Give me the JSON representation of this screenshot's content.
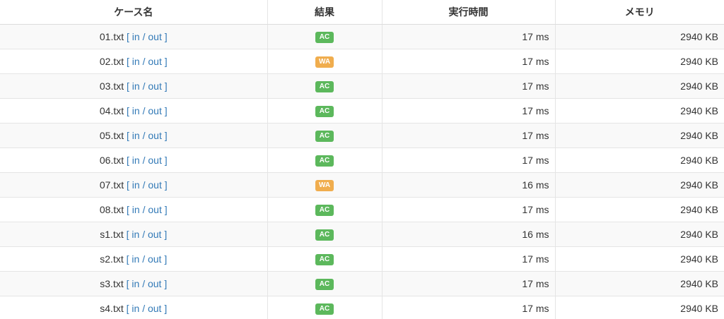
{
  "headers": {
    "case": "ケース名",
    "status": "結果",
    "time": "実行時間",
    "memory": "メモリ"
  },
  "link_labels": {
    "in": "in",
    "out": "out"
  },
  "status_colors": {
    "AC": "#5cb85c",
    "WA": "#f0ad4e"
  },
  "rows": [
    {
      "case": "01.txt",
      "status": "AC",
      "time": "17 ms",
      "memory": "2940 KB"
    },
    {
      "case": "02.txt",
      "status": "WA",
      "time": "17 ms",
      "memory": "2940 KB"
    },
    {
      "case": "03.txt",
      "status": "AC",
      "time": "17 ms",
      "memory": "2940 KB"
    },
    {
      "case": "04.txt",
      "status": "AC",
      "time": "17 ms",
      "memory": "2940 KB"
    },
    {
      "case": "05.txt",
      "status": "AC",
      "time": "17 ms",
      "memory": "2940 KB"
    },
    {
      "case": "06.txt",
      "status": "AC",
      "time": "17 ms",
      "memory": "2940 KB"
    },
    {
      "case": "07.txt",
      "status": "WA",
      "time": "16 ms",
      "memory": "2940 KB"
    },
    {
      "case": "08.txt",
      "status": "AC",
      "time": "17 ms",
      "memory": "2940 KB"
    },
    {
      "case": "s1.txt",
      "status": "AC",
      "time": "16 ms",
      "memory": "2940 KB"
    },
    {
      "case": "s2.txt",
      "status": "AC",
      "time": "17 ms",
      "memory": "2940 KB"
    },
    {
      "case": "s3.txt",
      "status": "AC",
      "time": "17 ms",
      "memory": "2940 KB"
    },
    {
      "case": "s4.txt",
      "status": "AC",
      "time": "17 ms",
      "memory": "2940 KB"
    }
  ]
}
